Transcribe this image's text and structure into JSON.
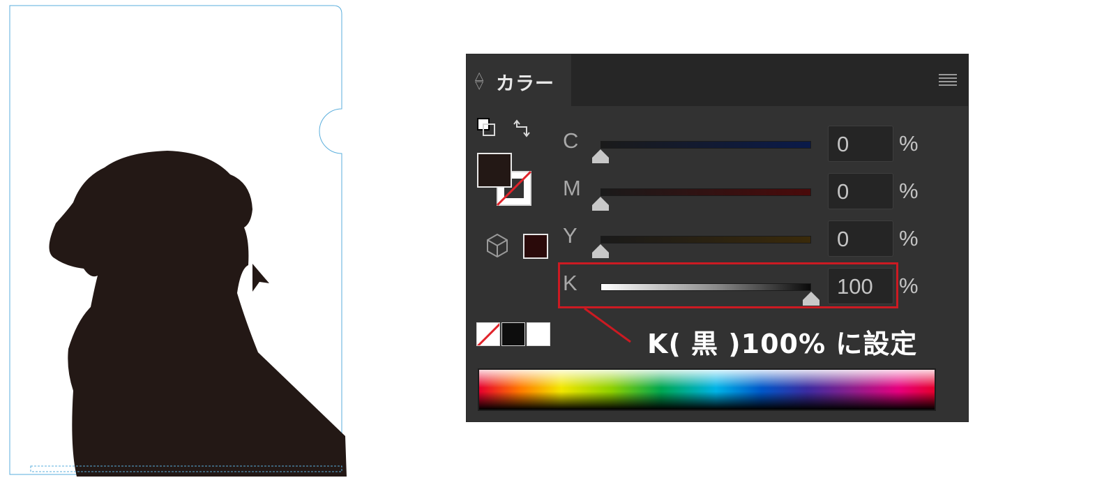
{
  "panel": {
    "tab_label": "カラー",
    "channels": [
      {
        "letter": "C",
        "value": "0",
        "unit": "%",
        "level": 0,
        "track_color": "#0a1a4a"
      },
      {
        "letter": "M",
        "value": "0",
        "unit": "%",
        "level": 0,
        "track_color": "#4a0a0a"
      },
      {
        "letter": "Y",
        "value": "0",
        "unit": "%",
        "level": 0,
        "track_color": "#3a2a0a"
      },
      {
        "letter": "K",
        "value": "100",
        "unit": "%",
        "level": 100,
        "track_color": "#ffffff"
      }
    ],
    "fill_color": "#231815",
    "gamut_swatch_color": "#2a0a0a"
  },
  "annotation": {
    "text": "K( 黒 )100% に設定",
    "color": "#cc1a22"
  },
  "artboard": {
    "silhouette_color": "#231815",
    "trim_line_color": "#5aaedc"
  }
}
